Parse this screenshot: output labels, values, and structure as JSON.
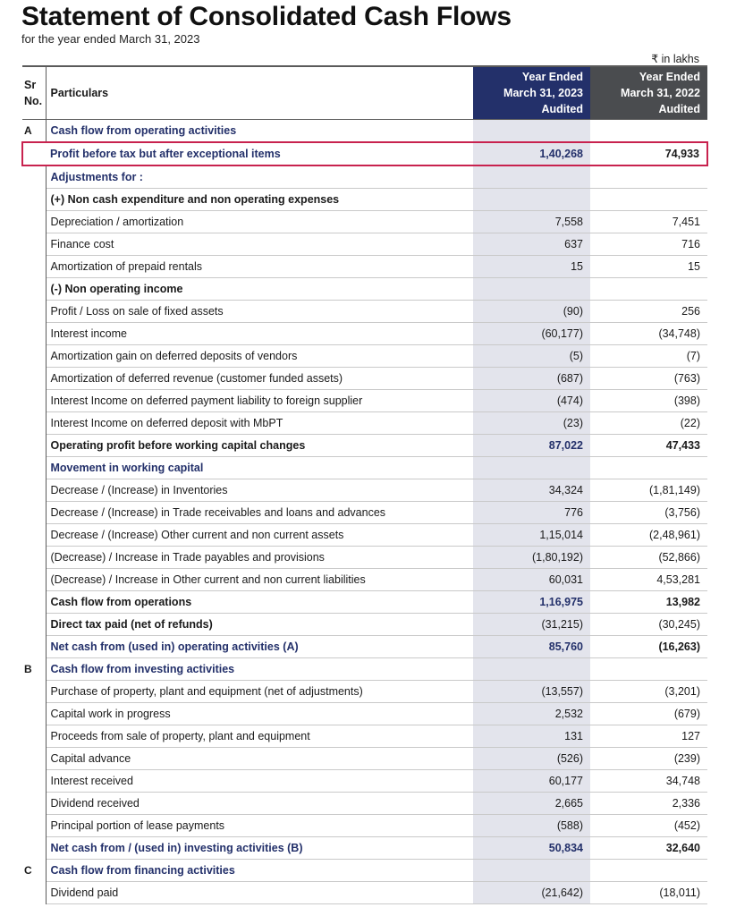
{
  "header": {
    "title": "Statement of Consolidated Cash Flows",
    "subtitle": "for the year ended March 31, 2023",
    "unit": "₹ in lakhs"
  },
  "table": {
    "columns": {
      "sr": "Sr No.",
      "particulars": "Particulars",
      "year1": [
        "Year Ended",
        "March 31, 2023",
        "Audited"
      ],
      "year2": [
        "Year Ended",
        "March 31, 2022",
        "Audited"
      ]
    },
    "colors": {
      "year1_header": "#23306a",
      "year2_header": "#4a4c4f",
      "highlight_border": "#c8224e",
      "year1_band": "#e3e4ec"
    },
    "rows": [
      {
        "sr": "A",
        "label": "Cash flow from operating activities",
        "v1": "",
        "v2": "",
        "style": "section"
      },
      {
        "sr": "",
        "label": "Profit before tax but after exceptional items",
        "v1": "1,40,268",
        "v2": "74,933",
        "style": "highlight"
      },
      {
        "sr": "",
        "label": "Adjustments for :",
        "v1": "",
        "v2": "",
        "style": "section"
      },
      {
        "sr": "",
        "label": "(+) Non cash expenditure and non operating expenses",
        "v1": "",
        "v2": "",
        "style": "sub"
      },
      {
        "sr": "",
        "label": "Depreciation / amortization",
        "v1": "7,558",
        "v2": "7,451",
        "style": ""
      },
      {
        "sr": "",
        "label": "Finance cost",
        "v1": "637",
        "v2": "716",
        "style": ""
      },
      {
        "sr": "",
        "label": "Amortization of prepaid rentals",
        "v1": "15",
        "v2": "15",
        "style": ""
      },
      {
        "sr": "",
        "label": "(-) Non operating income",
        "v1": "",
        "v2": "",
        "style": "sub"
      },
      {
        "sr": "",
        "label": "Profit / Loss on sale of fixed assets",
        "v1": "(90)",
        "v2": "256",
        "style": ""
      },
      {
        "sr": "",
        "label": "Interest income",
        "v1": "(60,177)",
        "v2": "(34,748)",
        "style": ""
      },
      {
        "sr": "",
        "label": "Amortization gain on deferred deposits of vendors",
        "v1": "(5)",
        "v2": "(7)",
        "style": ""
      },
      {
        "sr": "",
        "label": "Amortization of deferred revenue (customer funded assets)",
        "v1": "(687)",
        "v2": "(763)",
        "style": ""
      },
      {
        "sr": "",
        "label": "Interest Income on deferred payment liability to foreign supplier",
        "v1": "(474)",
        "v2": "(398)",
        "style": ""
      },
      {
        "sr": "",
        "label": "Interest Income on deferred deposit with MbPT",
        "v1": "(23)",
        "v2": "(22)",
        "style": ""
      },
      {
        "sr": "",
        "label": "Operating profit before working capital changes",
        "v1": "87,022",
        "v2": "47,433",
        "style": "bold"
      },
      {
        "sr": "",
        "label": "Movement in working capital",
        "v1": "",
        "v2": "",
        "style": "section"
      },
      {
        "sr": "",
        "label": "Decrease / (Increase) in Inventories",
        "v1": "34,324",
        "v2": "(1,81,149)",
        "style": ""
      },
      {
        "sr": "",
        "label": "Decrease / (Increase) in Trade receivables and loans and advances",
        "v1": "776",
        "v2": "(3,756)",
        "style": ""
      },
      {
        "sr": "",
        "label": "Decrease / (Increase) Other current and non current assets",
        "v1": "1,15,014",
        "v2": "(2,48,961)",
        "style": ""
      },
      {
        "sr": "",
        "label": "(Decrease) / Increase in Trade payables and provisions",
        "v1": "(1,80,192)",
        "v2": "(52,866)",
        "style": ""
      },
      {
        "sr": "",
        "label": "(Decrease) / Increase in Other current and non current liabilities",
        "v1": "60,031",
        "v2": "4,53,281",
        "style": ""
      },
      {
        "sr": "",
        "label": "Cash flow from operations",
        "v1": "1,16,975",
        "v2": "13,982",
        "style": "bold"
      },
      {
        "sr": "",
        "label": "Direct tax paid (net of refunds)",
        "v1": "(31,215)",
        "v2": "(30,245)",
        "style": "sub"
      },
      {
        "sr": "",
        "label": "Net cash from (used in) operating activities (A)",
        "v1": "85,760",
        "v2": "(16,263)",
        "style": "total"
      },
      {
        "sr": "B",
        "label": "Cash flow from investing activities",
        "v1": "",
        "v2": "",
        "style": "section"
      },
      {
        "sr": "",
        "label": "Purchase of property, plant and equipment (net of adjustments)",
        "v1": "(13,557)",
        "v2": "(3,201)",
        "style": ""
      },
      {
        "sr": "",
        "label": "Capital work in progress",
        "v1": "2,532",
        "v2": "(679)",
        "style": ""
      },
      {
        "sr": "",
        "label": "Proceeds from sale of property, plant and equipment",
        "v1": "131",
        "v2": "127",
        "style": ""
      },
      {
        "sr": "",
        "label": "Capital advance",
        "v1": "(526)",
        "v2": "(239)",
        "style": ""
      },
      {
        "sr": "",
        "label": "Interest received",
        "v1": "60,177",
        "v2": "34,748",
        "style": ""
      },
      {
        "sr": "",
        "label": "Dividend received",
        "v1": "2,665",
        "v2": "2,336",
        "style": ""
      },
      {
        "sr": "",
        "label": "Principal portion of lease payments",
        "v1": "(588)",
        "v2": "(452)",
        "style": ""
      },
      {
        "sr": "",
        "label": "Net cash from / (used in) investing activities (B)",
        "v1": "50,834",
        "v2": "32,640",
        "style": "total"
      },
      {
        "sr": "C",
        "label": "Cash flow from financing activities",
        "v1": "",
        "v2": "",
        "style": "section"
      },
      {
        "sr": "",
        "label": "Dividend paid",
        "v1": "(21,642)",
        "v2": "(18,011)",
        "style": ""
      }
    ]
  }
}
